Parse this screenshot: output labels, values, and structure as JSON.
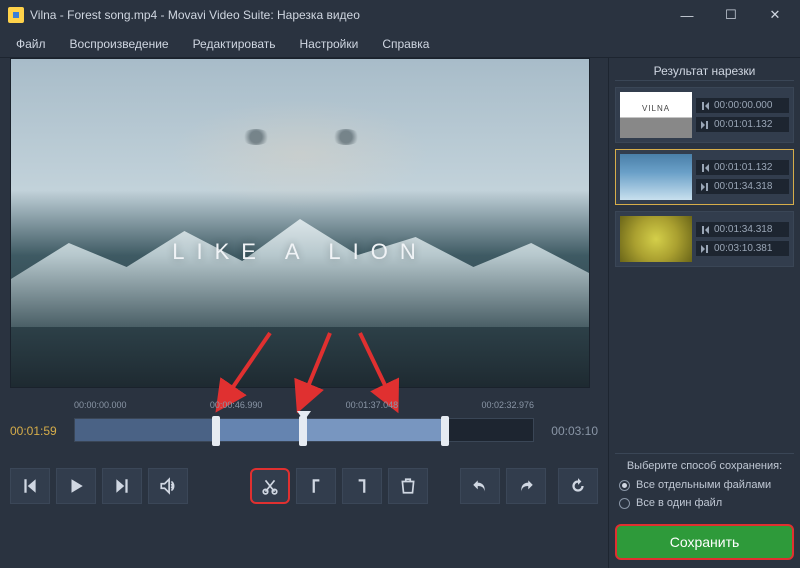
{
  "window": {
    "title": "Vilna - Forest song.mp4 - Movavi Video Suite: Нарезка видео"
  },
  "menu": {
    "file": "Файл",
    "playback": "Воспроизведение",
    "edit": "Редактировать",
    "settings": "Настройки",
    "help": "Справка"
  },
  "preview": {
    "overlay_text": "LIKE A LION"
  },
  "timeline": {
    "current": "00:01:59",
    "end": "00:03:10",
    "ticks": {
      "t0": "00:00:00.000",
      "t1": "00:00:46.990",
      "t2": "00:01:37.048",
      "t3": "00:02:32.976"
    }
  },
  "clips_panel": {
    "title": "Результат нарезки",
    "items": [
      {
        "start": "00:00:00.000",
        "end": "00:01:01.132",
        "selected": false
      },
      {
        "start": "00:01:01.132",
        "end": "00:01:34.318",
        "selected": true
      },
      {
        "start": "00:01:34.318",
        "end": "00:03:10.381",
        "selected": false
      }
    ]
  },
  "save": {
    "prompt": "Выберите способ сохранения:",
    "opt_separate": "Все отдельными файлами",
    "opt_single": "Все в один файл",
    "button": "Сохранить"
  }
}
